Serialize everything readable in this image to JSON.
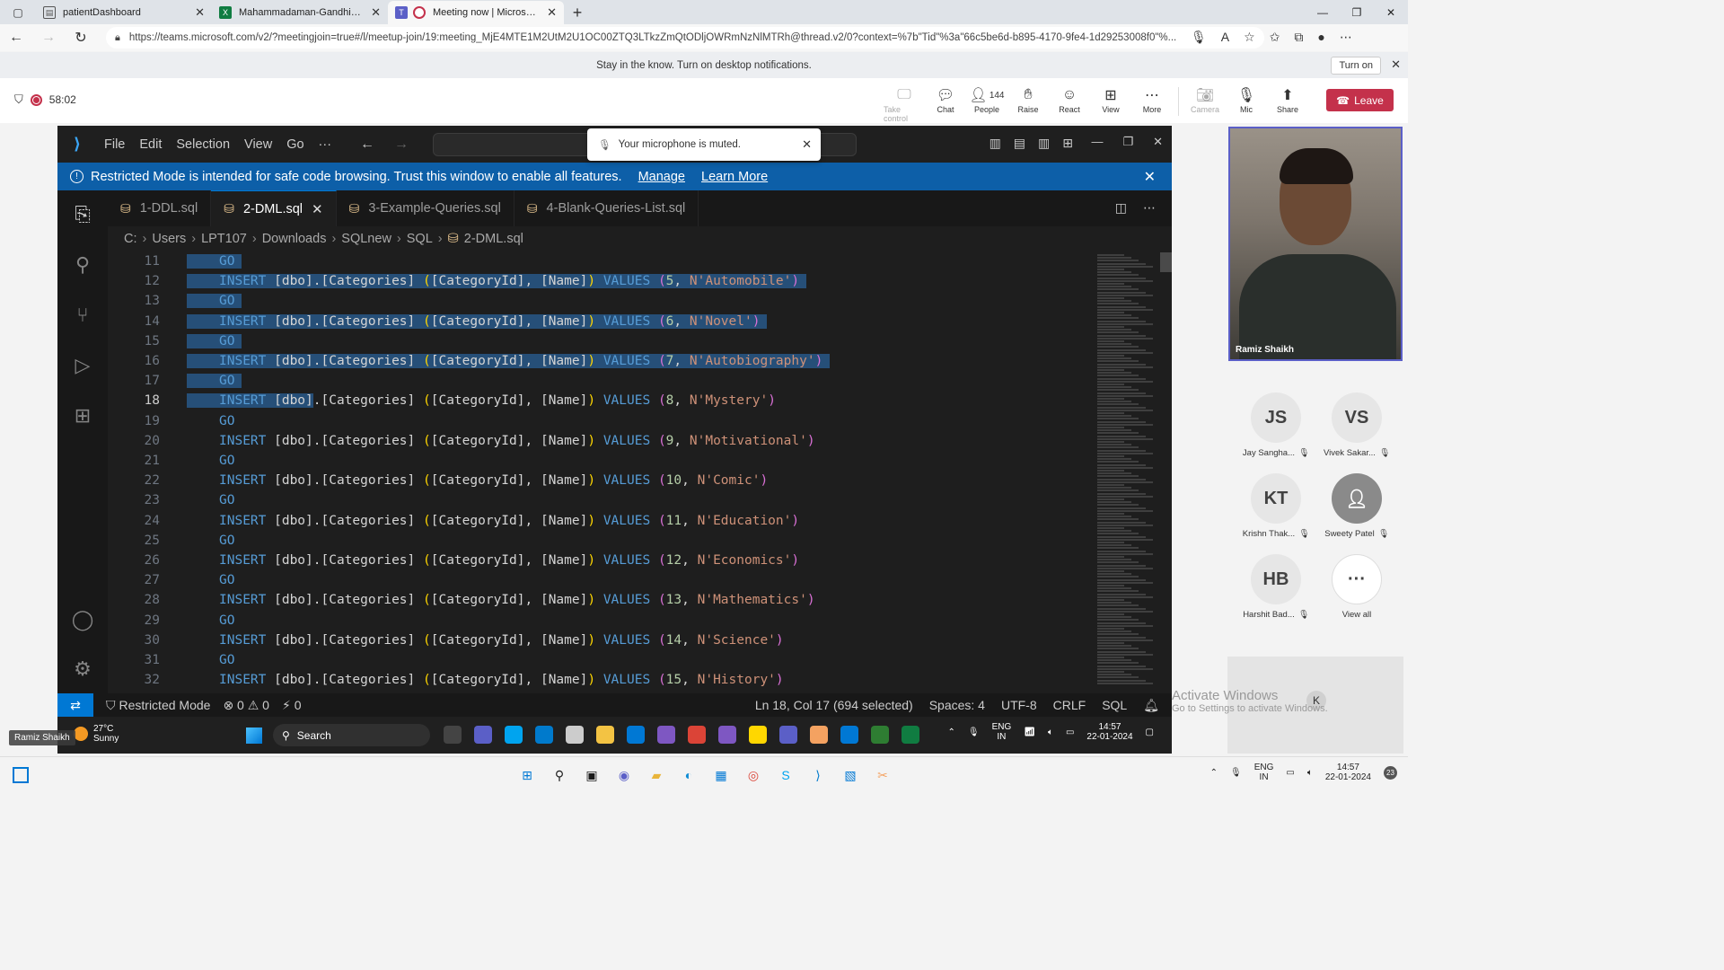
{
  "browser": {
    "tabs": [
      {
        "label": "patientDashboard",
        "favicon": "page-icon"
      },
      {
        "label": "Mahammadaman-Gandhi-Assessment",
        "favicon": "excel-icon"
      },
      {
        "label": "Meeting now | Microsoft Teams",
        "favicon": "teams-icon"
      }
    ],
    "url": "https://teams.microsoft.com/v2/?meetingjoin=true#/l/meetup-join/19:meeting_MjE4MTE1M2UtM2U1OC00ZTQ3LTkzZmQtODljOWRmNzNlMTRh@thread.v2/0?context=%7b\"Tid\"%3a\"66c5be6d-b895-4170-9fe4-1d29253008f0\"%..."
  },
  "notification": {
    "text": "Stay in the know. Turn on desktop notifications.",
    "button": "Turn on"
  },
  "teams": {
    "timer": "58:02",
    "toolbar": [
      {
        "label": "Take control",
        "icon": "take-control-icon",
        "dim": true
      },
      {
        "label": "Chat",
        "icon": "chat-icon"
      },
      {
        "label": "People",
        "icon": "people-icon",
        "count": "144"
      },
      {
        "label": "Raise",
        "icon": "raise-hand-icon"
      },
      {
        "label": "React",
        "icon": "react-icon"
      },
      {
        "label": "View",
        "icon": "view-icon"
      },
      {
        "label": "More",
        "icon": "more-icon"
      },
      {
        "label": "Camera",
        "icon": "camera-off-icon",
        "dim": true
      },
      {
        "label": "Mic",
        "icon": "mic-off-icon"
      },
      {
        "label": "Share",
        "icon": "share-icon"
      }
    ],
    "leave": "Leave",
    "toast": "Your microphone is muted."
  },
  "vscode": {
    "menu": [
      "File",
      "Edit",
      "Selection",
      "View",
      "Go",
      "···"
    ],
    "restricted_text": "Restricted Mode is intended for safe code browsing. Trust this window to enable all features.",
    "restricted_links": [
      "Manage",
      "Learn More"
    ],
    "tabs": [
      {
        "label": "1-DDL.sql",
        "active": false
      },
      {
        "label": "2-DML.sql",
        "active": true
      },
      {
        "label": "3-Example-Queries.sql",
        "active": false
      },
      {
        "label": "4-Blank-Queries-List.sql",
        "active": false
      }
    ],
    "breadcrumb": [
      "C:",
      "Users",
      "LPT107",
      "Downloads",
      "SQLnew",
      "SQL",
      "2-DML.sql"
    ],
    "current_line": 18,
    "lines": [
      {
        "n": 11,
        "type": "go",
        "sel": "full"
      },
      {
        "n": 12,
        "type": "insert",
        "id": "5",
        "name": "N'Automobile'",
        "sel": "full"
      },
      {
        "n": 13,
        "type": "go",
        "sel": "full"
      },
      {
        "n": 14,
        "type": "insert",
        "id": "6",
        "name": "N'Novel'",
        "sel": "full"
      },
      {
        "n": 15,
        "type": "go",
        "sel": "full"
      },
      {
        "n": 16,
        "type": "insert",
        "id": "7",
        "name": "N'Autobiography'",
        "sel": "full"
      },
      {
        "n": 17,
        "type": "go",
        "sel": "full"
      },
      {
        "n": 18,
        "type": "insert",
        "id": "8",
        "name": "N'Mystery'",
        "sel": "partial"
      },
      {
        "n": 19,
        "type": "go"
      },
      {
        "n": 20,
        "type": "insert",
        "id": "9",
        "name": "N'Motivational'"
      },
      {
        "n": 21,
        "type": "go"
      },
      {
        "n": 22,
        "type": "insert",
        "id": "10",
        "name": "N'Comic'"
      },
      {
        "n": 23,
        "type": "go"
      },
      {
        "n": 24,
        "type": "insert",
        "id": "11",
        "name": "N'Education'"
      },
      {
        "n": 25,
        "type": "go"
      },
      {
        "n": 26,
        "type": "insert",
        "id": "12",
        "name": "N'Economics'"
      },
      {
        "n": 27,
        "type": "go"
      },
      {
        "n": 28,
        "type": "insert",
        "id": "13",
        "name": "N'Mathematics'"
      },
      {
        "n": 29,
        "type": "go"
      },
      {
        "n": 30,
        "type": "insert",
        "id": "14",
        "name": "N'Science'"
      },
      {
        "n": 31,
        "type": "go"
      },
      {
        "n": 32,
        "type": "insert",
        "id": "15",
        "name": "N'History'"
      }
    ],
    "status": {
      "mode": "Restricted Mode",
      "problems": "⊗ 0 ⚠ 0",
      "ports": "⚡ 0",
      "position": "Ln 18, Col 17 (694 selected)",
      "spaces": "Spaces: 4",
      "encoding": "UTF-8",
      "eol": "CRLF",
      "language": "SQL"
    },
    "inner_taskbar": {
      "temp": "27°C",
      "weather": "Sunny",
      "search": "Search",
      "lang": "ENG",
      "region": "IN",
      "time": "14:57",
      "date": "22-01-2024"
    }
  },
  "presenter_tag": "Ramiz Shaikh",
  "participants": {
    "speaker": "Ramiz Shaikh",
    "list": [
      {
        "initials": "JS",
        "name": "Jay Sangha..."
      },
      {
        "initials": "VS",
        "name": "Vivek Sakar..."
      },
      {
        "initials": "KT",
        "name": "Krishn Thak..."
      },
      {
        "initials": "",
        "name": "Sweety Patel"
      },
      {
        "initials": "HB",
        "name": "Harshit Bad..."
      },
      {
        "initials": "···",
        "name": "View all"
      }
    ],
    "tile_initial": "K"
  },
  "watermark": {
    "title": "Activate Windows",
    "sub": "Go to Settings to activate Windows."
  },
  "taskbar": {
    "lang": "ENG",
    "region": "IN",
    "time": "14:57",
    "date": "22-01-2024",
    "badge": "23"
  }
}
